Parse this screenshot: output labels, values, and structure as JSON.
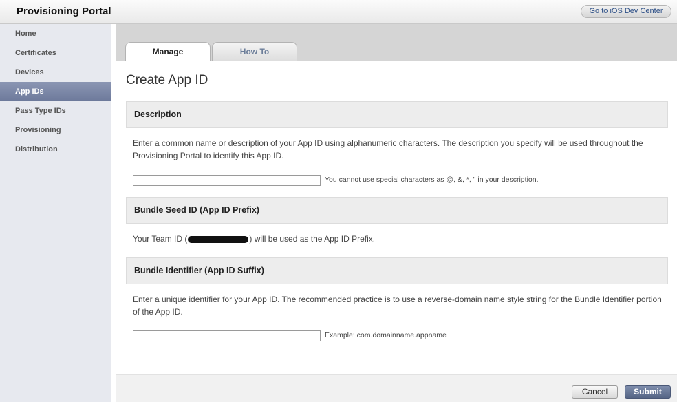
{
  "header": {
    "title": "Provisioning Portal",
    "devcenter_link": "Go to iOS Dev Center"
  },
  "sidebar": {
    "items": [
      {
        "label": "Home"
      },
      {
        "label": "Certificates"
      },
      {
        "label": "Devices"
      },
      {
        "label": "App IDs",
        "active": true
      },
      {
        "label": "Pass Type IDs"
      },
      {
        "label": "Provisioning"
      },
      {
        "label": "Distribution"
      }
    ]
  },
  "tabs": {
    "manage": "Manage",
    "howto": "How To"
  },
  "page": {
    "title": "Create App ID"
  },
  "description": {
    "heading": "Description",
    "text": "Enter a common name or description of your App ID using alphanumeric characters. The description you specify will be used throughout the Provisioning Portal to identify this App ID.",
    "input_value": "",
    "hint": "You cannot use special characters as @, &, *, \" in your description."
  },
  "bundle_seed": {
    "heading": "Bundle Seed ID (App ID Prefix)",
    "text_before": "Your Team ID (",
    "text_after": ") will be used as the App ID Prefix."
  },
  "bundle_identifier": {
    "heading": "Bundle Identifier (App ID Suffix)",
    "text": "Enter a unique identifier for your App ID. The recommended practice is to use a reverse-domain name style string for the Bundle Identifier portion of the App ID.",
    "input_value": "",
    "hint": "Example: com.domainname.appname"
  },
  "footer": {
    "cancel": "Cancel",
    "submit": "Submit"
  },
  "colors": {
    "active_nav": "#7281a1",
    "submit_button": "#5c6b8b",
    "section_background": "#ededed"
  }
}
